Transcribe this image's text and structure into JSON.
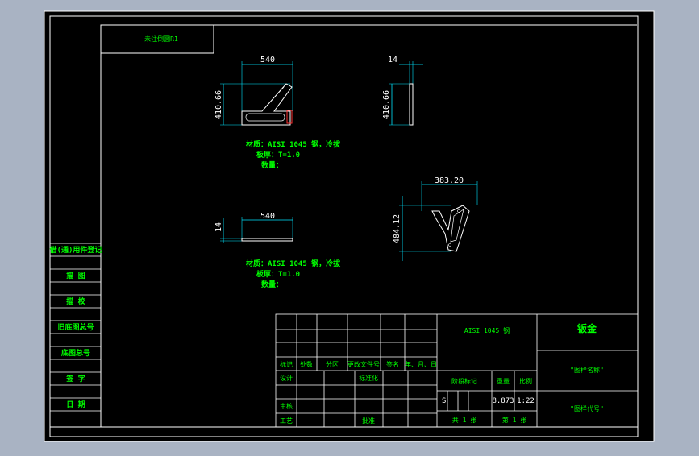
{
  "drawing_frame": {
    "top_left_box_text": "未注倒圆R1"
  },
  "views": {
    "front": {
      "width_dim": "540",
      "height_dim": "410.66"
    },
    "side": {
      "width_dim": "14",
      "height_dim": "410.66"
    },
    "top": {
      "width_dim": "540",
      "height_dim": "14"
    },
    "iso": {
      "width_dim": "383.20",
      "height_dim": "484.12"
    }
  },
  "notes_1": [
    "材质：AISI 1045 钢，冷拔",
    "板厚：T=1.0",
    "数量："
  ],
  "notes_2": [
    "材质：AISI 1045 钢，冷拔",
    "板厚：T=1.0",
    "数量："
  ],
  "side_table": [
    "借(通)用件登记",
    "描 图",
    "描 校",
    "旧底图总号",
    "底图总号",
    "签 字",
    "日 期"
  ],
  "title_block": {
    "header_cols": [
      "标记",
      "处数",
      "分区",
      "更改文件号",
      "签名",
      "年、月、日"
    ],
    "left_rows": [
      "设计",
      "审核",
      "工艺"
    ],
    "std_label": "标准化",
    "approve_label": "批准",
    "material": "AISI 1045 钢",
    "company": "钣金",
    "drawing_name": "\"图样名称\"",
    "drawing_code": "\"图样代号\"",
    "stage_label": "阶段标记",
    "weight_label": "重量",
    "scale_label": "比例",
    "stage_value": "S",
    "weight_value": "8.873",
    "scale_value": "1:22",
    "sheets_total": "共 1 张",
    "sheet_no": "第 1 张"
  },
  "colors": {
    "frame": "#ffffff",
    "dim": "#00e5ff",
    "text": "#00ff00",
    "part": "#ffffff",
    "accent": "#ff3030"
  }
}
